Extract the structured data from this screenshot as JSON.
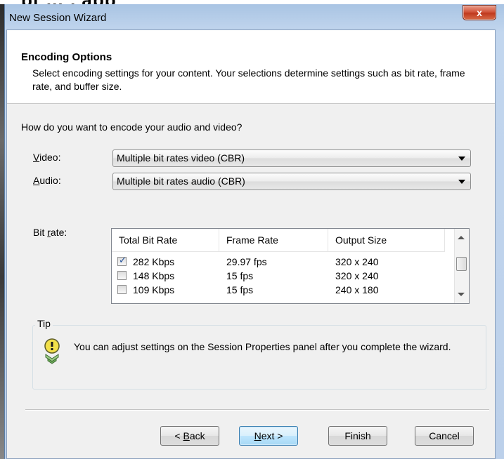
{
  "window": {
    "title": "New Session Wizard",
    "close_label": "x"
  },
  "header": {
    "title": "Encoding Options",
    "description": "Select encoding settings for your content. Your selections determine settings such as bit rate, frame rate, and buffer size."
  },
  "form": {
    "question": "How do you want to encode your audio and video?",
    "video": {
      "label_underline": "V",
      "label_rest": "ideo:",
      "value": "Multiple bit rates video (CBR)"
    },
    "audio": {
      "label_underline": "A",
      "label_rest": "udio:",
      "value": "Multiple bit rates audio (CBR)"
    },
    "bitrate": {
      "label_pre": "Bit ",
      "label_underline": "r",
      "label_rest": "ate:"
    }
  },
  "bitrate_table": {
    "columns": [
      "Total Bit Rate",
      "Frame Rate",
      "Output Size"
    ],
    "rows": [
      {
        "checked": true,
        "bitrate": "282 Kbps",
        "framerate": "29.97 fps",
        "size": "320 x 240"
      },
      {
        "checked": false,
        "bitrate": "148 Kbps",
        "framerate": "15 fps",
        "size": "320 x 240"
      },
      {
        "checked": false,
        "bitrate": "109 Kbps",
        "framerate": "15 fps",
        "size": "240 x 180"
      }
    ]
  },
  "tip": {
    "legend": "Tip",
    "text": "You can adjust settings on the Session Properties panel after you complete the wizard."
  },
  "buttons": {
    "back_pre": "< ",
    "back_underline": "B",
    "back_rest": "ack",
    "next_underline": "N",
    "next_rest": "ext >",
    "finish": "Finish",
    "cancel": "Cancel"
  },
  "colors": {
    "titlebar": "#c2d6ee",
    "close_button": "#c0391e",
    "dialog_bg": "#f0f0f0",
    "default_button": "#bee6fd"
  }
}
